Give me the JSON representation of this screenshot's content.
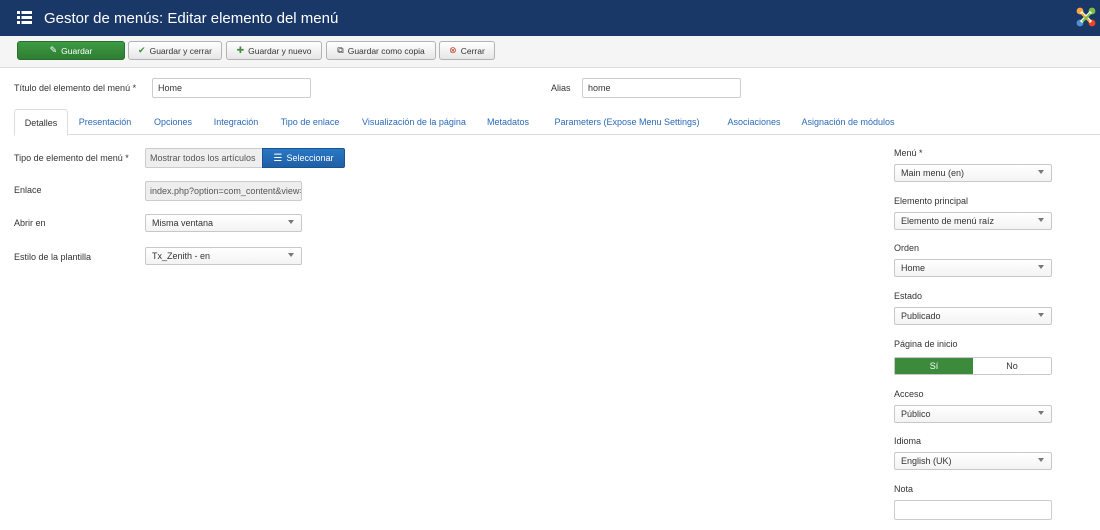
{
  "header": {
    "title": "Gestor de menús: Editar elemento del menú"
  },
  "toolbar": {
    "save": "Guardar",
    "save_close": "Guardar y cerrar",
    "save_new": "Guardar y nuevo",
    "save_copy": "Guardar como copia",
    "close": "Cerrar"
  },
  "title_field": {
    "label": "Título del elemento del menú *",
    "value": "Home"
  },
  "alias_field": {
    "label": "Alias",
    "value": "home"
  },
  "tabs": [
    "Detalles",
    "Presentación",
    "Opciones",
    "Integración",
    "Tipo de enlace",
    "Visualización de la página",
    "Metadatos",
    "Parameters (Expose Menu Settings)",
    "Asociaciones",
    "Asignación de módulos"
  ],
  "details": {
    "item_type": {
      "label": "Tipo de elemento del menú *",
      "value": "Mostrar todos los artículos",
      "button": "Seleccionar"
    },
    "link": {
      "label": "Enlace",
      "value": "index.php?option=com_content&view=category"
    },
    "target": {
      "label": "Abrir en",
      "value": "Misma ventana"
    },
    "template_style": {
      "label": "Estilo de la plantilla",
      "value": "Tx_Zenith - en"
    }
  },
  "sidebar": {
    "menu": {
      "label": "Menú *",
      "value": "Main menu (en)"
    },
    "parent": {
      "label": "Elemento principal",
      "value": "Elemento de menú raíz"
    },
    "ordering": {
      "label": "Orden",
      "value": "Home"
    },
    "status": {
      "label": "Estado",
      "value": "Publicado"
    },
    "home": {
      "label": "Página de inicio",
      "yes": "Sí",
      "no": "No",
      "selected": "Sí"
    },
    "access": {
      "label": "Acceso",
      "value": "Público"
    },
    "language": {
      "label": "Idioma",
      "value": "English (UK)"
    },
    "note": {
      "label": "Nota",
      "value": ""
    }
  },
  "colors": {
    "header": "#1a3867",
    "save": "#3d9b45",
    "select": "#1f5fa6",
    "toggle_on": "#3c8a3c",
    "link": "#2a69b8"
  }
}
